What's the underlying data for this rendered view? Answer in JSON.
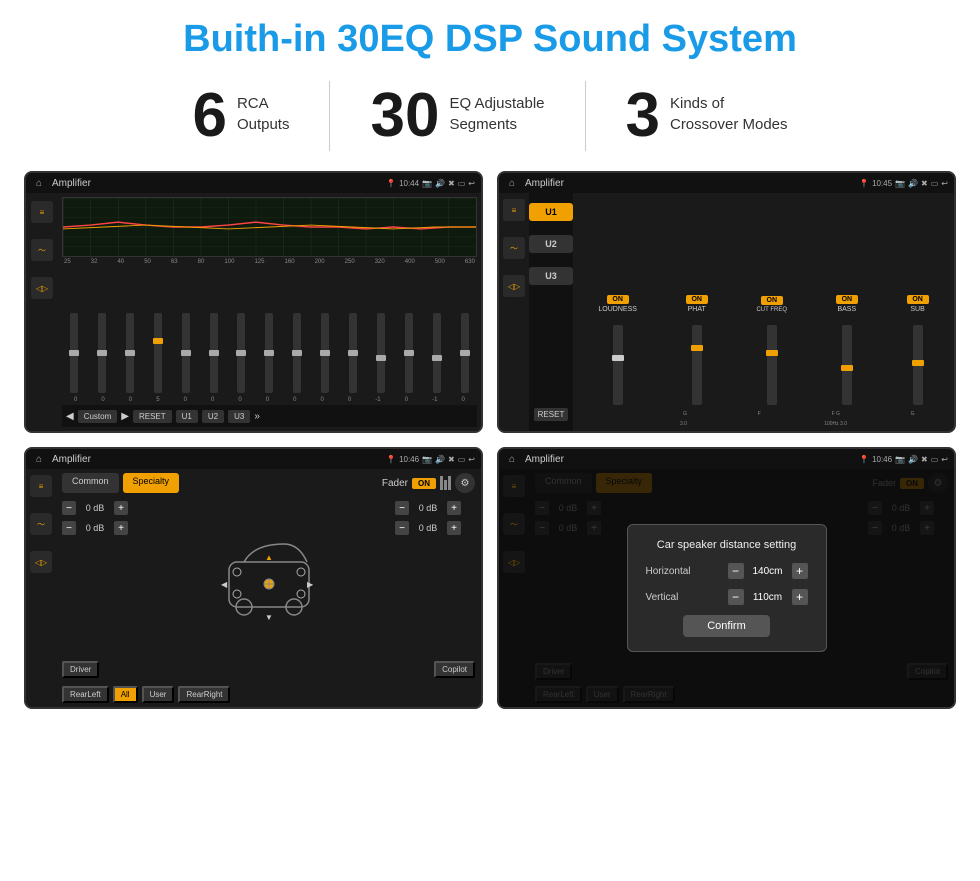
{
  "header": {
    "title": "Buith-in 30EQ DSP Sound System"
  },
  "stats": [
    {
      "number": "6",
      "line1": "RCA",
      "line2": "Outputs"
    },
    {
      "number": "30",
      "line1": "EQ Adjustable",
      "line2": "Segments"
    },
    {
      "number": "3",
      "line1": "Kinds of",
      "line2": "Crossover Modes"
    }
  ],
  "screens": [
    {
      "id": "screen1",
      "status_title": "Amplifier",
      "time": "10:44",
      "eq_freqs": [
        "25",
        "32",
        "40",
        "50",
        "63",
        "80",
        "100",
        "125",
        "160",
        "200",
        "250",
        "320",
        "400",
        "500",
        "630"
      ],
      "eq_values": [
        "0",
        "0",
        "0",
        "5",
        "0",
        "0",
        "0",
        "0",
        "0",
        "0",
        "0",
        "-1",
        "0",
        "-1",
        "0"
      ],
      "bottom_buttons": [
        "Custom",
        "RESET",
        "U1",
        "U2",
        "U3"
      ]
    },
    {
      "id": "screen2",
      "status_title": "Amplifier",
      "time": "10:45",
      "u_buttons": [
        "U1",
        "U2",
        "U3"
      ],
      "channels": [
        "LOUDNESS",
        "PHAT",
        "CUT FREQ",
        "BASS",
        "SUB"
      ],
      "reset": "RESET"
    },
    {
      "id": "screen3",
      "status_title": "Amplifier",
      "time": "10:46",
      "tabs": [
        "Common",
        "Specialty"
      ],
      "fader_label": "Fader",
      "on": "ON",
      "db_values": [
        "0 dB",
        "0 dB",
        "0 dB",
        "0 dB"
      ],
      "bottom_buttons_left": [
        "Driver"
      ],
      "bottom_buttons_right": [
        "Copilot"
      ],
      "bottom_row": [
        "RearLeft",
        "All",
        "User",
        "RearRight"
      ]
    },
    {
      "id": "screen4",
      "status_title": "Amplifier",
      "time": "10:46",
      "tabs": [
        "Common",
        "Specialty"
      ],
      "dialog": {
        "title": "Car speaker distance setting",
        "horizontal_label": "Horizontal",
        "horizontal_value": "140cm",
        "vertical_label": "Vertical",
        "vertical_value": "110cm",
        "confirm": "Confirm"
      },
      "bottom_right": [
        "Copilot"
      ],
      "bottom_row": [
        "RearLeft",
        "User",
        "RearRight"
      ]
    }
  ]
}
